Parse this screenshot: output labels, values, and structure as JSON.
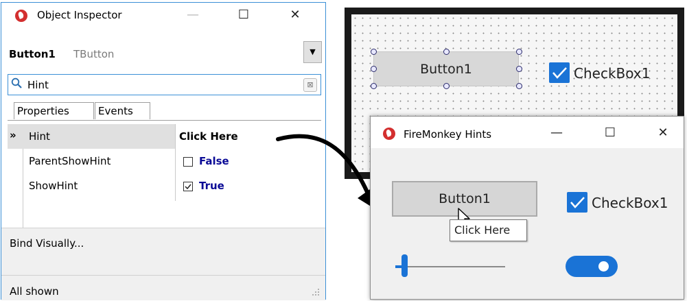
{
  "object_inspector": {
    "title": "Object Inspector",
    "min_glyph": "—",
    "max_glyph": "☐",
    "close_glyph": "✕",
    "component_name": "Button1",
    "component_type": "TButton",
    "dropdown_glyph": "▼",
    "search": {
      "value": "Hint",
      "icon": "search-icon",
      "clear_glyph": "⊠"
    },
    "tabs": [
      {
        "label": "Properties",
        "active": true
      },
      {
        "label": "Events",
        "active": false
      }
    ],
    "properties": [
      {
        "name": "Hint",
        "value": "Click Here",
        "kind": "text",
        "selected": true,
        "marker": "»"
      },
      {
        "name": "ParentShowHint",
        "value": "False",
        "kind": "bool",
        "checked": false
      },
      {
        "name": "ShowHint",
        "value": "True",
        "kind": "bool",
        "checked": true
      }
    ],
    "bind_label": "Bind Visually...",
    "status": "All shown"
  },
  "designer": {
    "button_label": "Button1",
    "checkbox_label": "CheckBox1",
    "checkbox_checked": true
  },
  "firemonkey_window": {
    "title": "FireMonkey Hints",
    "min_glyph": "—",
    "max_glyph": "☐",
    "close_glyph": "✕",
    "button_label": "Button1",
    "tooltip": "Click Here",
    "checkbox_label": "CheckBox1",
    "checkbox_checked": true,
    "slider_value": 0.1,
    "switch_on": true
  },
  "colors": {
    "accent": "#1a73d6",
    "window_border": "#3a8fd6",
    "selected_row": "#e0e0e0",
    "bool_value": "#0a0a96",
    "app_icon": "#d32f2f"
  }
}
